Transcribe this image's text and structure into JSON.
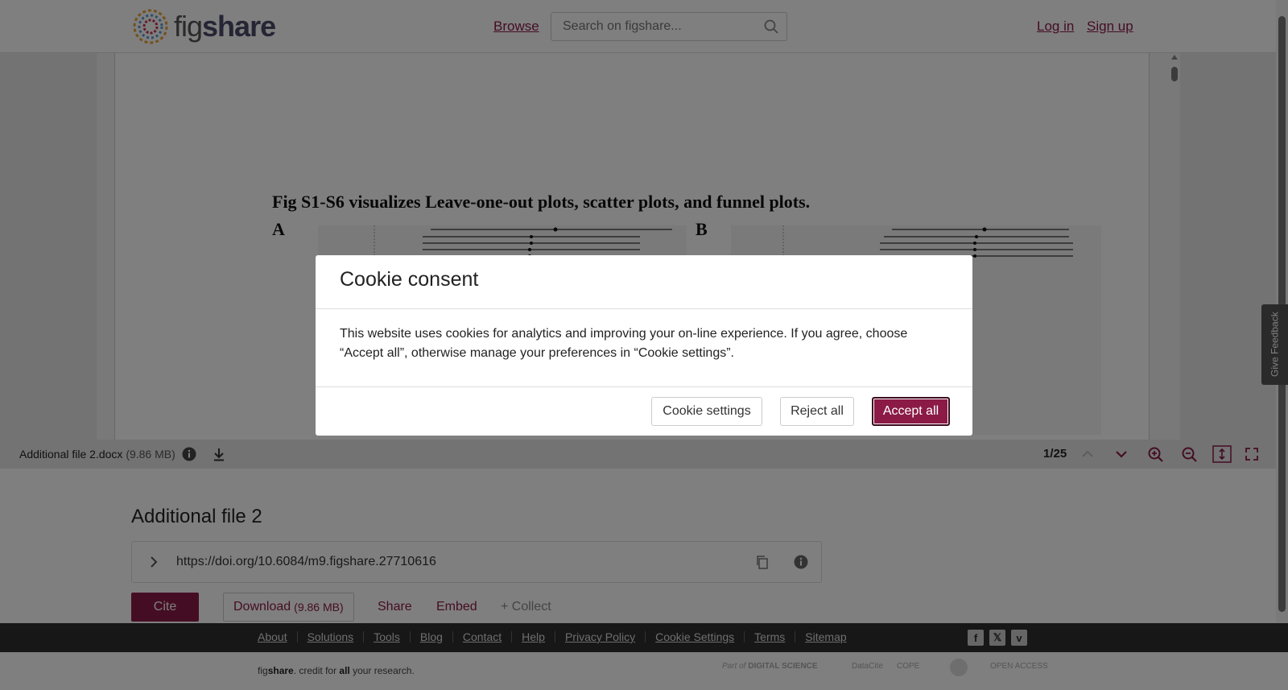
{
  "header": {
    "logo_fig": "fig",
    "logo_share": "share",
    "browse": "Browse",
    "search_placeholder": "Search on figshare...",
    "login": "Log in",
    "signup": "Sign up"
  },
  "viewer": {
    "doc_title": "Fig S1-S6 visualizes Leave-one-out plots, scatter plots, and funnel plots.",
    "panel_a": "A",
    "panel_b": "B",
    "file_name": "Additional file 2.docx",
    "file_size": "(9.86 MB)",
    "page_count": "1/25"
  },
  "item": {
    "title": "Additional file 2",
    "doi": "https://doi.org/10.6084/m9.figshare.27710616",
    "cite": "Cite",
    "download": "Download",
    "download_size": "(9.86 MB)",
    "share": "Share",
    "embed": "Embed",
    "collect": "+ Collect"
  },
  "footer": {
    "links": [
      "About",
      "Solutions",
      "Tools",
      "Blog",
      "Contact",
      "Help",
      "Privacy Policy",
      "Cookie Settings",
      "Terms",
      "Sitemap"
    ],
    "tagline_fig": "fig",
    "tagline_share": "share",
    "tagline_mid": ". credit for ",
    "tagline_all": "all",
    "tagline_end": " your research.",
    "partner_part_of": "Part of",
    "partner_ds": "DIGITAL SCIENCE",
    "partner_datacite": "DataCite",
    "partner_cope": "COPE",
    "partner_oa": "OPEN ACCESS"
  },
  "modal": {
    "title": "Cookie consent",
    "body": "This website uses cookies for analytics and improving your on-line experience. If you agree, choose “Accept all”, otherwise manage your preferences in “Cookie settings”.",
    "settings": "Cookie settings",
    "reject": "Reject all",
    "accept": "Accept all"
  },
  "feedback": "Give Feedback",
  "colors": {
    "brand": "#8b1a46",
    "footer": "#2e2e2e"
  }
}
